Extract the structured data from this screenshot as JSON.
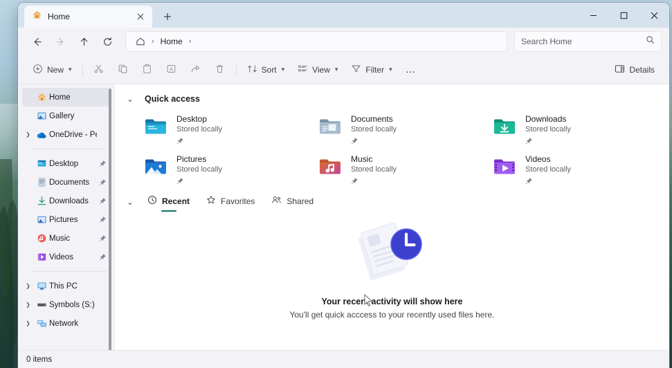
{
  "window": {
    "title": "Home",
    "controls": {
      "minimize": "minimize-button",
      "maximize": "maximize-button",
      "close": "close-button"
    },
    "new_tab_label": "+"
  },
  "tabs": [
    {
      "label": "Home",
      "icon": "home-icon",
      "active": true
    }
  ],
  "address": {
    "back": "Back",
    "forward": "Forward",
    "up": "Up",
    "refresh": "Refresh",
    "breadcrumbs": [
      {
        "label": "",
        "icon": "home-icon"
      },
      {
        "label": "Home",
        "icon": ""
      }
    ],
    "separator": "›"
  },
  "search": {
    "placeholder": "Search Home",
    "value": "",
    "icon": "search-icon"
  },
  "toolbar": {
    "new_label": "New",
    "sort_label": "Sort",
    "view_label": "View",
    "filter_label": "Filter",
    "overflow_label": "…",
    "details_label": "Details",
    "icons": {
      "new": "plus-circle-icon",
      "cut": "scissors-icon",
      "copy": "copy-icon",
      "paste": "paste-icon",
      "rename": "rename-icon",
      "share": "share-icon",
      "delete": "trash-icon",
      "sort": "sort-icon",
      "view": "view-icon",
      "filter": "filter-icon",
      "details": "details-pane-icon"
    }
  },
  "sidebar": {
    "items": [
      {
        "label": "Home",
        "icon": "home-icon",
        "selected": true,
        "expandable": false,
        "pinned": false
      },
      {
        "label": "Gallery",
        "icon": "gallery-icon",
        "selected": false,
        "expandable": false,
        "pinned": false
      },
      {
        "label": "OneDrive - Pers",
        "icon": "onedrive-icon",
        "selected": false,
        "expandable": true,
        "pinned": false
      },
      {
        "separator": true
      },
      {
        "label": "Desktop",
        "icon": "desktop-icon",
        "selected": false,
        "expandable": false,
        "pinned": true
      },
      {
        "label": "Documents",
        "icon": "documents-icon",
        "selected": false,
        "expandable": false,
        "pinned": true
      },
      {
        "label": "Downloads",
        "icon": "downloads-icon",
        "selected": false,
        "expandable": false,
        "pinned": true
      },
      {
        "label": "Pictures",
        "icon": "pictures-icon",
        "selected": false,
        "expandable": false,
        "pinned": true
      },
      {
        "label": "Music",
        "icon": "music-icon",
        "selected": false,
        "expandable": false,
        "pinned": true
      },
      {
        "label": "Videos",
        "icon": "videos-icon",
        "selected": false,
        "expandable": false,
        "pinned": true
      },
      {
        "separator": true
      },
      {
        "label": "This PC",
        "icon": "thispc-icon",
        "selected": false,
        "expandable": true,
        "pinned": false
      },
      {
        "label": "Symbols (S:)",
        "icon": "drive-icon",
        "selected": false,
        "expandable": true,
        "pinned": false
      },
      {
        "label": "Network",
        "icon": "network-icon",
        "selected": false,
        "expandable": true,
        "pinned": false
      }
    ]
  },
  "quick_access": {
    "title": "Quick access",
    "expanded": true,
    "items": [
      {
        "name": "Desktop",
        "status": "Stored locally",
        "icon": "folder-desktop-icon",
        "pinned": true
      },
      {
        "name": "Documents",
        "status": "Stored locally",
        "icon": "folder-documents-icon",
        "pinned": true
      },
      {
        "name": "Downloads",
        "status": "Stored locally",
        "icon": "folder-downloads-icon",
        "pinned": true
      },
      {
        "name": "Pictures",
        "status": "Stored locally",
        "icon": "folder-pictures-icon",
        "pinned": true
      },
      {
        "name": "Music",
        "status": "Stored locally",
        "icon": "folder-music-icon",
        "pinned": true
      },
      {
        "name": "Videos",
        "status": "Stored locally",
        "icon": "folder-videos-icon",
        "pinned": true
      }
    ]
  },
  "file_tabs": [
    {
      "label": "Recent",
      "icon": "clock-icon",
      "active": true
    },
    {
      "label": "Favorites",
      "icon": "star-icon",
      "active": false
    },
    {
      "label": "Shared",
      "icon": "people-icon",
      "active": false
    }
  ],
  "empty_state": {
    "title": "Your recent activity will show here",
    "subtitle": "You'll get quick acccess to your recently used files here.",
    "illustration": "documents-clock-illustration"
  },
  "status_bar": {
    "item_count": "0 items"
  },
  "colors": {
    "accent_teal": "#0f6e64",
    "titlebar": "#d6e3ee",
    "chrome": "#f3f3f7",
    "content": "#ffffff",
    "selected_nav": "#e3e3ec",
    "clock_blue": "#3b40cf"
  }
}
